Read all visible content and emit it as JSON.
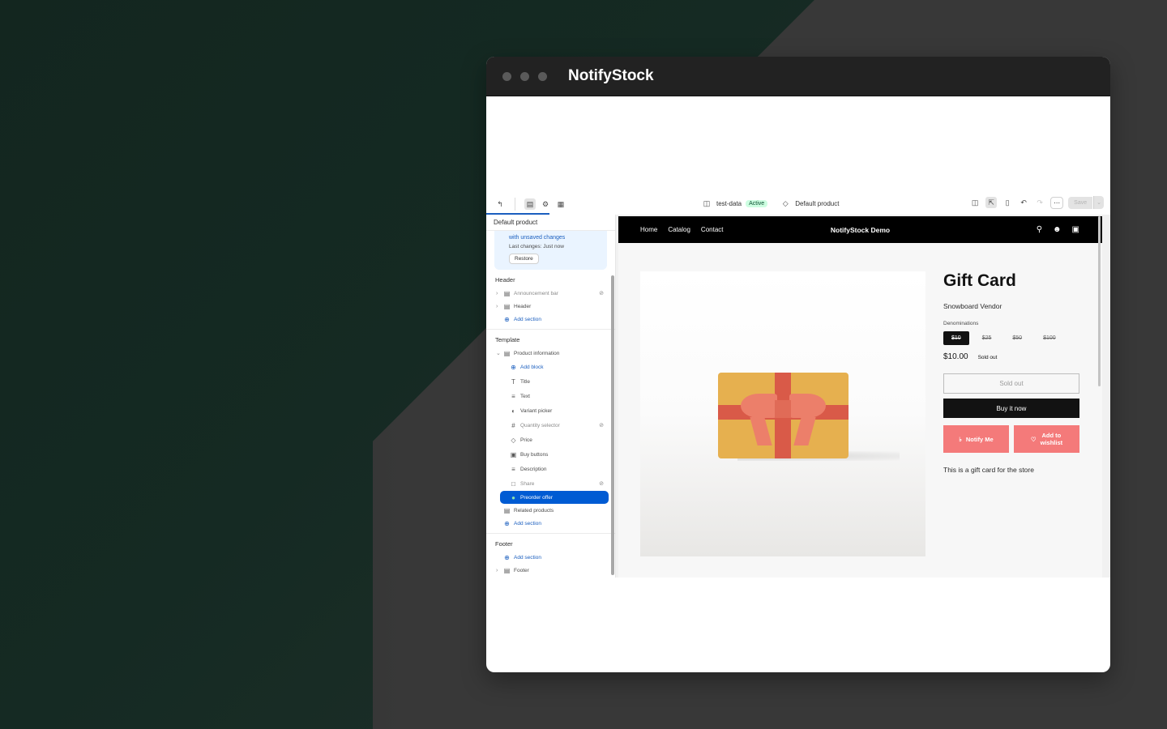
{
  "app": {
    "title": "NotifyStock"
  },
  "topbar": {
    "store": "test-data",
    "store_status": "Active",
    "template": "Default product",
    "save_label": "Save"
  },
  "sidebar": {
    "title": "Default product",
    "notice": {
      "line1": "with unsaved changes",
      "line2": "Last changes: Just now",
      "restore_label": "Restore"
    },
    "header_group": {
      "title": "Header",
      "items": [
        "Announcement bar",
        "Header"
      ],
      "add_section": "Add section"
    },
    "template_group": {
      "title": "Template",
      "section": "Product information",
      "add_block": "Add block",
      "blocks": [
        "Title",
        "Text",
        "Variant picker",
        "Quantity selector",
        "Price",
        "Buy buttons",
        "Description",
        "Share",
        "Preorder offer"
      ],
      "related": "Related products",
      "add_section": "Add section"
    },
    "footer_group": {
      "title": "Footer",
      "add_section": "Add section",
      "item": "Footer"
    }
  },
  "store": {
    "nav_links": [
      "Home",
      "Catalog",
      "Contact"
    ],
    "brand": "NotifyStock Demo",
    "product": {
      "title": "Gift Card",
      "vendor": "Snowboard Vendor",
      "denominations_label": "Denominations",
      "denominations": [
        "$10",
        "$25",
        "$50",
        "$100"
      ],
      "price": "$10.00",
      "sold_out_badge": "Sold out",
      "sold_out_button": "Sold out",
      "buy_now": "Buy it now",
      "notify_me": "Notify Me",
      "wishlist_line1": "Add to",
      "wishlist_line2": "wishlist",
      "description": "This is a gift card for the store"
    }
  },
  "colors": {
    "accent": "#005bd3",
    "pink_button": "#f47a7a",
    "active_badge": "#cdfee1"
  }
}
